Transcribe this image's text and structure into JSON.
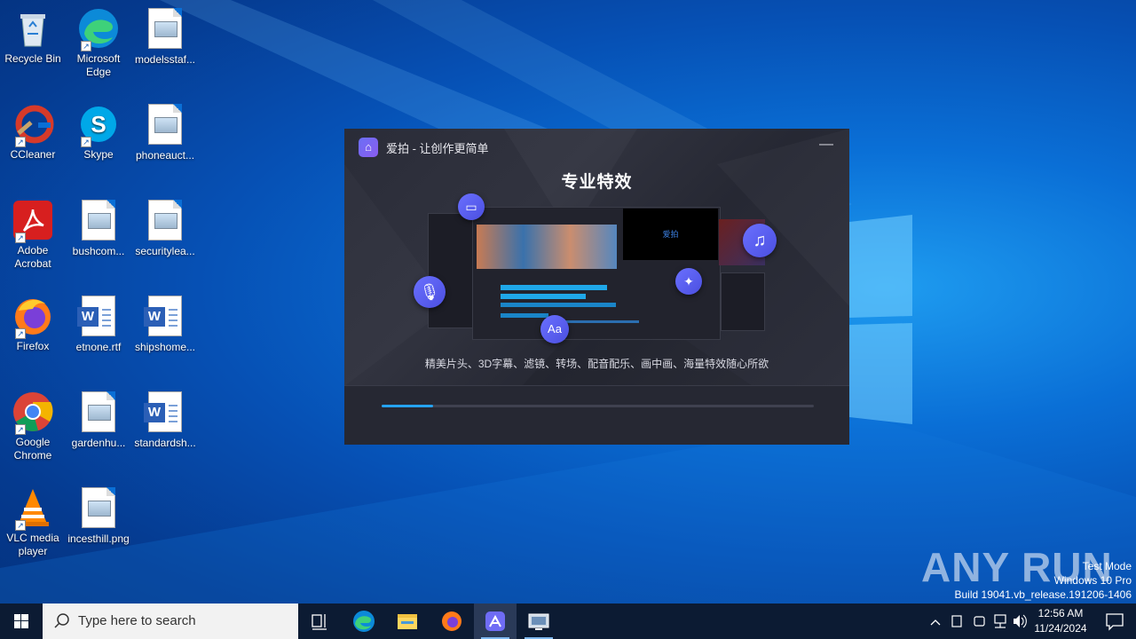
{
  "desktop": {
    "icons": [
      {
        "label": "Recycle Bin"
      },
      {
        "label": "Microsoft Edge"
      },
      {
        "label": "modelsstaf..."
      },
      {
        "label": "CCleaner"
      },
      {
        "label": "Skype"
      },
      {
        "label": "phoneauct..."
      },
      {
        "label": "Adobe Acrobat"
      },
      {
        "label": "bushcom..."
      },
      {
        "label": "securitylea..."
      },
      {
        "label": "Firefox"
      },
      {
        "label": "etnone.rtf"
      },
      {
        "label": "shipshome..."
      },
      {
        "label": "Google Chrome"
      },
      {
        "label": "gardenhu..."
      },
      {
        "label": "standardsh..."
      },
      {
        "label": "VLC media player"
      },
      {
        "label": "incesthill.png"
      }
    ]
  },
  "app_window": {
    "title": "爱拍 - 让创作更简单",
    "minimize_glyph": "—",
    "headline": "专业特效",
    "subline": "精美片头、3D字幕、滤镜、转场、配音配乐、画中画、海量特效随心所欲",
    "mock_logo": "爱拍",
    "bubble_text": "Aa",
    "progress": 0.12,
    "accent": "#25a3f0"
  },
  "taskbar": {
    "search_placeholder": "Type here to search",
    "icons": [
      "task-view-icon",
      "edge-icon",
      "file-explorer-icon",
      "firefox-icon",
      "aipai-icon",
      "network-app-icon"
    ],
    "clock_time": "12:56 AM",
    "clock_date": "11/24/2024"
  },
  "watermark": {
    "line1": "Test Mode",
    "line2": "Windows 10 Pro",
    "line3": "Build 19041.vb_release.191206-1406",
    "brand": "ANY RUN"
  }
}
